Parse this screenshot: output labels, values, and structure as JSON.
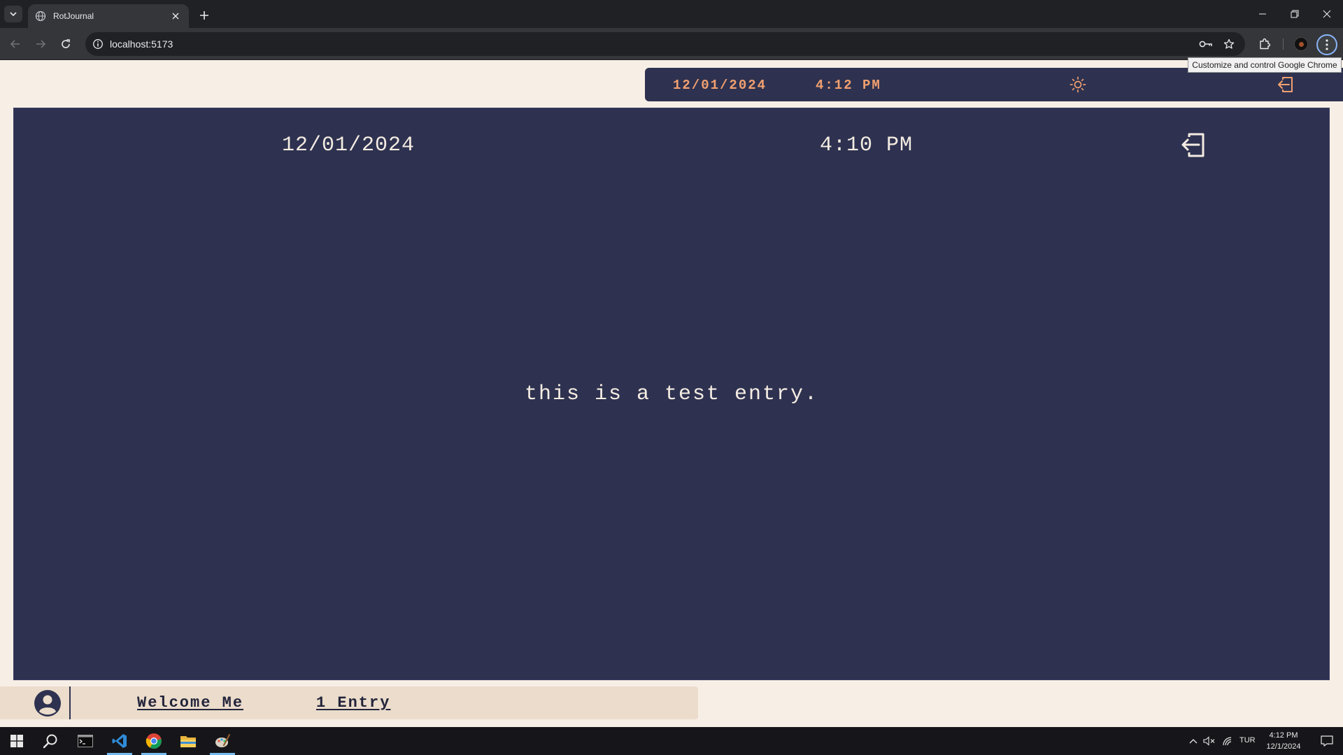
{
  "browser": {
    "tab": {
      "title": "RotJournal"
    },
    "address_bar": {
      "url": "localhost:5173"
    },
    "tooltip": "Customize and control Google Chrome"
  },
  "app": {
    "header": {
      "date": "12/01/2024",
      "time": "4:12 PM"
    },
    "entry": {
      "date": "12/01/2024",
      "time": "4:10 PM",
      "text": "this is a test entry."
    },
    "footer": {
      "welcome": "Welcome Me",
      "entries": "1 Entry"
    },
    "colors": {
      "page_background": "#f7efe6",
      "card": "#2e3250",
      "accent": "#f1a070",
      "text_light": "#f4ece2",
      "footer_bar": "#ebdccb"
    }
  },
  "taskbar": {
    "apps": [
      "start-icon",
      "search-icon",
      "terminal-icon",
      "vscode-icon",
      "chrome-icon",
      "file-explorer-icon",
      "paint-icon"
    ],
    "language": "TUR",
    "time": "4:12 PM",
    "date": "12/1/2024"
  }
}
